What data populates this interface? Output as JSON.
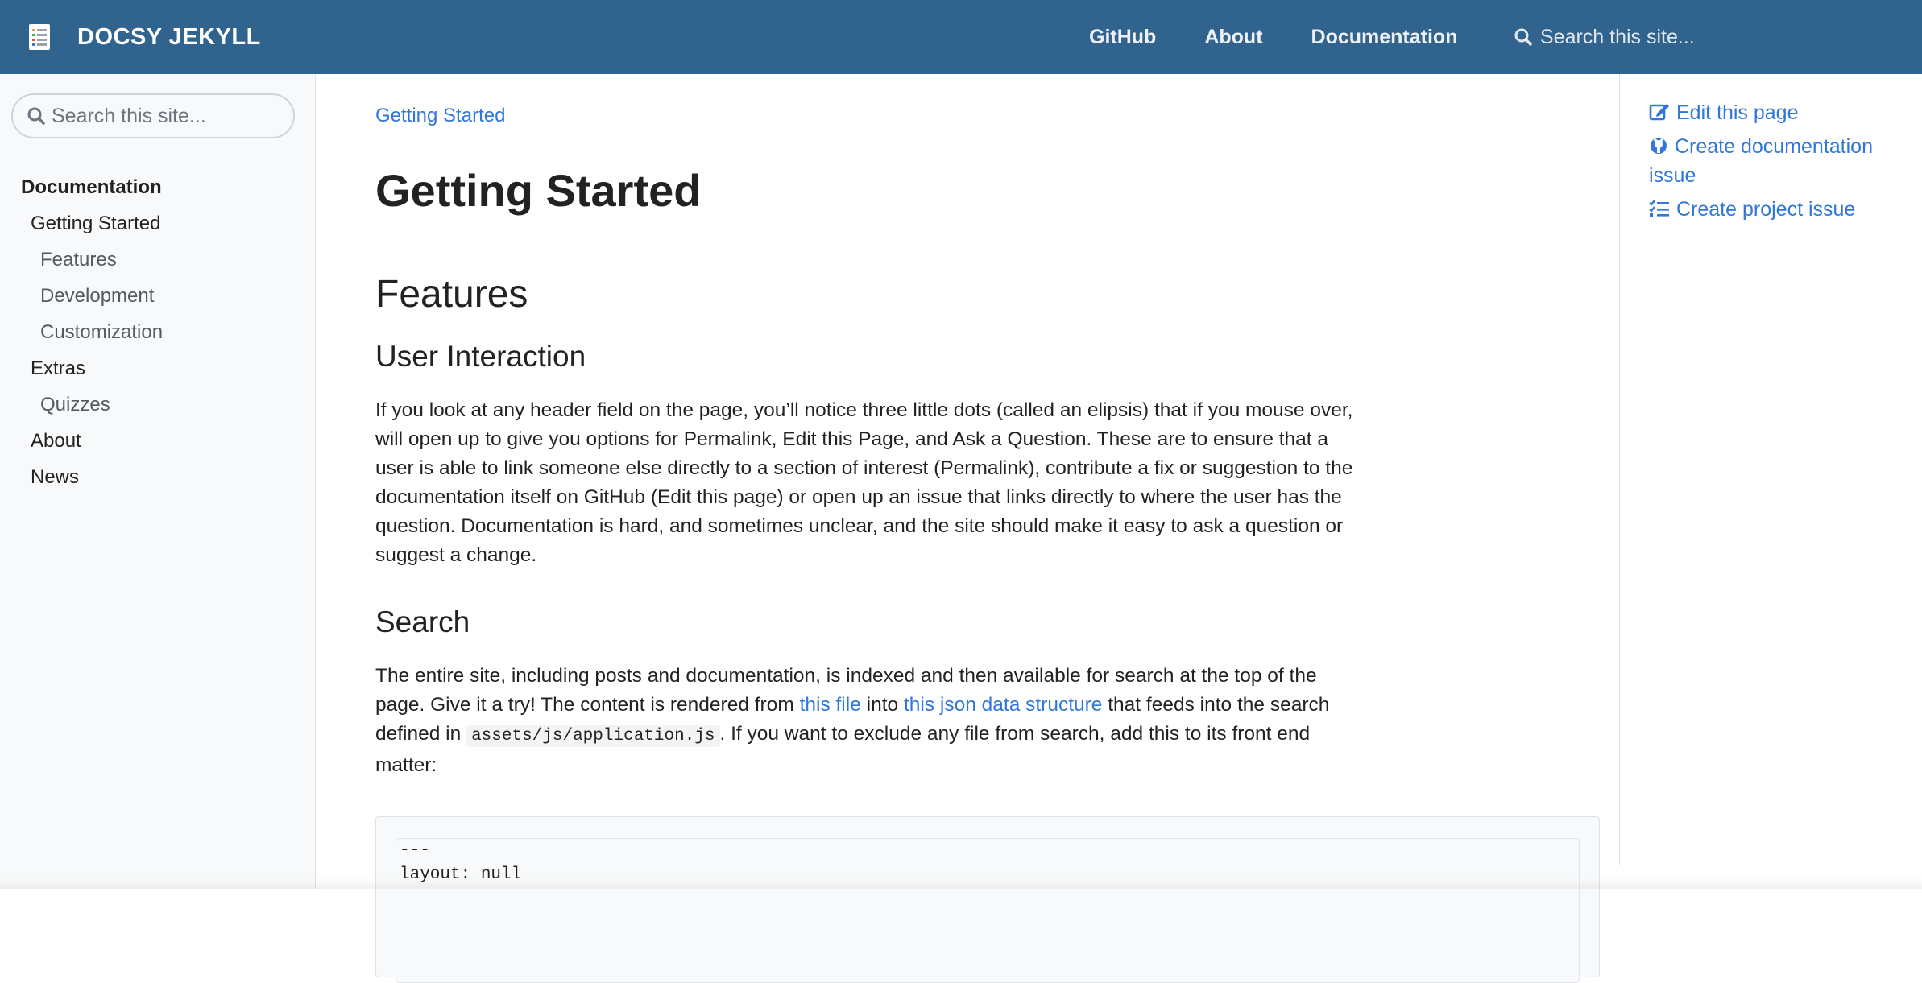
{
  "navbar": {
    "brand_icon": "doc-list-logo-icon",
    "brand_name": "DOCSY JEKYLL",
    "links": [
      "GitHub",
      "About",
      "Documentation"
    ],
    "search_placeholder": "Search this site..."
  },
  "sidebar": {
    "search_placeholder": "Search this site...",
    "items": [
      {
        "label": "Documentation",
        "level": 0
      },
      {
        "label": "Getting Started",
        "level": 1
      },
      {
        "label": "Features",
        "level": 2
      },
      {
        "label": "Development",
        "level": 2
      },
      {
        "label": "Customization",
        "level": 2
      },
      {
        "label": "Extras",
        "level": 1
      },
      {
        "label": "Quizzes",
        "level": 2
      },
      {
        "label": "About",
        "level": 1
      },
      {
        "label": "News",
        "level": 1
      }
    ]
  },
  "main": {
    "breadcrumb": "Getting Started",
    "title": "Getting Started",
    "section_heading": "Features",
    "user_interaction": {
      "heading": "User Interaction",
      "text": "If you look at any header field on the page, you’ll notice three little dots (called an elipsis) that if you mouse over, will open up to give you options for Permalink, Edit this Page, and Ask a Question. These are to ensure that a user is able to link someone else directly to a section of interest (Permalink), contribute a fix or suggestion to the documentation itself on GitHub (Edit this page) or open up an issue that links directly to where the user has the question. Documentation is hard, and sometimes unclear, and the site should make it easy to ask a question or suggest a change."
    },
    "search": {
      "heading": "Search",
      "text_1": "The entire site, including posts and documentation, is indexed and then available for search at the top of the page. Give it a try! The content is rendered from ",
      "link_1": "this file",
      "text_2": " into ",
      "link_2": "this json data structure",
      "text_3": " that feeds into the search defined in ",
      "code": "assets/js/application.js",
      "text_4": ". If you want to exclude any file from search, add this to its front end matter:"
    },
    "code_block": [
      "---",
      "layout: null"
    ]
  },
  "toc": {
    "edit_page": "Edit this page",
    "create_doc_issue": "Create documentation issue",
    "create_project_issue": "Create project issue"
  },
  "colors": {
    "navbar": "#30638e",
    "link": "#3176d9",
    "sidebar_bg": "#f8f9fa"
  }
}
